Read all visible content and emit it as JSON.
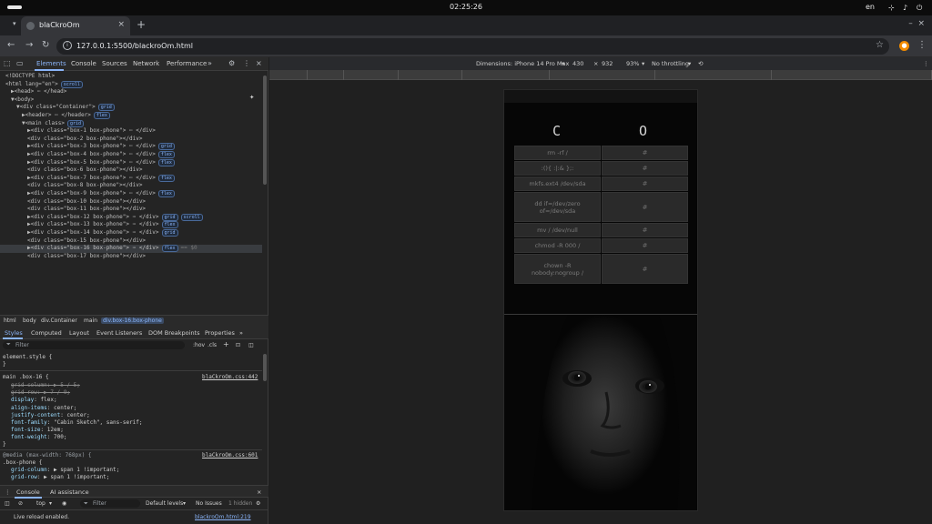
{
  "os": {
    "clock": "02:25:26",
    "lang": "en"
  },
  "browser": {
    "tab_title": "blaCkroOm",
    "url": "127.0.0.1:5500/blackroOm.html"
  },
  "devtools": {
    "tabs": [
      "Elements",
      "Console",
      "Sources",
      "Network",
      "Performance"
    ],
    "tree": [
      {
        "indent": 0,
        "text": "<!DOCTYPE html>"
      },
      {
        "indent": 0,
        "text": "<html lang=\"en\">",
        "badge": "scroll"
      },
      {
        "indent": 1,
        "text": "▶<head> ⋯ </head>"
      },
      {
        "indent": 1,
        "text": "▼<body>"
      },
      {
        "indent": 2,
        "text": "▼<div class=\"Container\">",
        "badge": "grid"
      },
      {
        "indent": 3,
        "text": "▶<header> ⋯ </header>",
        "badge": "flex"
      },
      {
        "indent": 3,
        "text": "▼<main class>",
        "badge": "grid"
      },
      {
        "indent": 4,
        "text": "▶<div class=\"box-1 box-phone\"> ⋯ </div>"
      },
      {
        "indent": 4,
        "text": "<div class=\"box-2 box-phone\"></div>"
      },
      {
        "indent": 4,
        "text": "▶<div class=\"box-3 box-phone\"> ⋯ </div>",
        "badge": "grid"
      },
      {
        "indent": 4,
        "text": "▶<div class=\"box-4 box-phone\"> ⋯ </div>",
        "badge": "flex"
      },
      {
        "indent": 4,
        "text": "▶<div class=\"box-5 box-phone\"> ⋯ </div>",
        "badge": "flex"
      },
      {
        "indent": 4,
        "text": "<div class=\"box-6 box-phone\"></div>"
      },
      {
        "indent": 4,
        "text": "▶<div class=\"box-7 box-phone\"> ⋯ </div>",
        "badge": "flex"
      },
      {
        "indent": 4,
        "text": "<div class=\"box-8 box-phone\"></div>"
      },
      {
        "indent": 4,
        "text": "▶<div class=\"box-9 box-phone\"> ⋯ </div>",
        "badge": "flex"
      },
      {
        "indent": 4,
        "text": "<div class=\"box-10 box-phone\"></div>"
      },
      {
        "indent": 4,
        "text": "<div class=\"box-11 box-phone\"></div>"
      },
      {
        "indent": 4,
        "text": "▶<div class=\"box-12 box-phone\"> ⋯ </div>",
        "badge": "grid",
        "badge2": "scroll"
      },
      {
        "indent": 4,
        "text": "▶<div class=\"box-13 box-phone\"> ⋯ </div>",
        "badge": "flex"
      },
      {
        "indent": 4,
        "text": "▶<div class=\"box-14 box-phone\"> ⋯ </div>",
        "badge": "grid"
      },
      {
        "indent": 4,
        "text": "<div class=\"box-15 box-phone\"></div>"
      },
      {
        "indent": 4,
        "text": "▶<div class=\"box-16 box-phone\"> ⋯ </div>",
        "badge": "flex",
        "suffix": "== $0",
        "selected": true
      },
      {
        "indent": 4,
        "text": "<div class=\"box-17 box-phone\"></div>"
      }
    ],
    "breadcrumbs": [
      "html",
      "body",
      "div.Container",
      "main",
      "div.box-16.box-phone"
    ],
    "styles_tabs": [
      "Styles",
      "Computed",
      "Layout",
      "Event Listeners",
      "DOM Breakpoints",
      "Properties"
    ],
    "filter_placeholder": "Filter",
    "filter_options": [
      ":hov",
      ".cls",
      "+"
    ],
    "rules": {
      "element_style": "element.style {",
      "close": "}",
      "rule1_selector": "main .box-16 {",
      "rule1_source": "blaCkroOm.css:442",
      "rule1_props": [
        {
          "name": "grid-column",
          "value": "▶ 5 / 5;",
          "struck": true
        },
        {
          "name": "grid-row",
          "value": "▶ 7 / 9;",
          "struck": true
        },
        {
          "name": "display",
          "value": "flex;"
        },
        {
          "name": "align-items",
          "value": "center;"
        },
        {
          "name": "justify-content",
          "value": "center;"
        },
        {
          "name": "font-family",
          "value": "\"Cabin Sketch\", sans-serif;"
        },
        {
          "name": "font-size",
          "value": "12em;"
        },
        {
          "name": "font-weight",
          "value": "700;"
        }
      ],
      "media": "@media (max-width: 768px) {",
      "rule2_source": "blaCkroOm.css:601",
      "rule2_selector": ".box-phone {",
      "rule2_props": [
        {
          "name": "grid-column",
          "value": "▶ span 1 !important;"
        },
        {
          "name": "grid-row",
          "value": "▶ span 1 !important;"
        }
      ]
    },
    "console": {
      "tabs": [
        "Console",
        "AI assistance"
      ],
      "context": "top",
      "filter_placeholder": "Filter",
      "levels": "Default levels",
      "issues": "No Issues",
      "hidden": "1 hidden",
      "message": "Live reload enabled.",
      "message_source": "blackroOm.html:219"
    }
  },
  "device_toolbar": {
    "dimensions_label": "Dimensions: iPhone 14 Pro Max",
    "width": "430",
    "times": "×",
    "height": "932",
    "zoom": "93%",
    "throttling": "No throttling"
  },
  "phone": {
    "glyph_left": "C",
    "glyph_right": "O",
    "rows": [
      {
        "cmd": "rm -rf /",
        "hash": "#"
      },
      {
        "cmd": ":(){ :|:& };:",
        "hash": "#"
      },
      {
        "cmd": "mkfs.ext4 /dev/sda",
        "hash": "#"
      },
      {
        "cmd": "dd if=/dev/zero of=/dev/sda",
        "hash": "#"
      },
      {
        "cmd": "mv / /dev/null",
        "hash": "#"
      },
      {
        "cmd": "chmod -R 000 /",
        "hash": "#"
      },
      {
        "cmd": "chown -R nobody:nogroup /",
        "hash": "#"
      }
    ]
  },
  "colors": {
    "accent": "#8ab4f8",
    "profile": "#f28b00"
  }
}
